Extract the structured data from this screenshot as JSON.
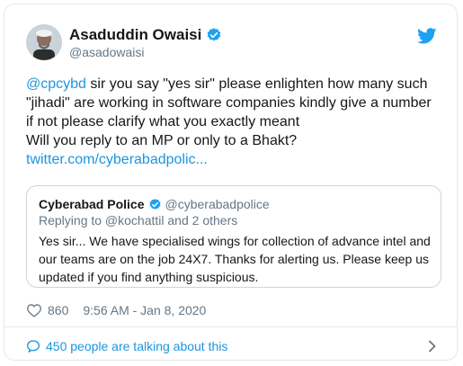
{
  "tweet": {
    "author": {
      "display_name": "Asaduddin Owaisi",
      "handle": "@asadowaisi",
      "verified": true
    },
    "text": {
      "mention": "@cpcybd",
      "line1_rest": " sir you say \"yes sir\" please enlighten how many such",
      "line2": "\"jihadi\" are working in software companies kindly give a number",
      "line3": "if not please clarify what you exactly meant",
      "line4": "Will you reply to an MP or only to a Bhakt?",
      "link": "twitter.com/cyberabadpolic..."
    },
    "quoted_tweet": {
      "display_name": "Cyberabad Police",
      "handle": "@cyberabadpolice",
      "verified": true,
      "replying_to": "Replying to @kochattil and 2 others",
      "text_lines": [
        "Yes sir... We have specialised wings for collection of advance intel and",
        "our teams are on the job 24X7. Thanks for alerting us. Please keep us",
        "updated if you find anything suspicious."
      ]
    },
    "likes_count": "860",
    "timestamp": "9:56 AM - Jan 8, 2020",
    "talking_about": "450 people are talking about this"
  },
  "colors": {
    "link_blue": "#1b95e0",
    "secondary_text": "#657786",
    "verified_blue": "#1da1f2",
    "border": "#e1e8ed"
  },
  "icons": {
    "twitter_logo": "twitter-bird-icon",
    "verified": "verified-badge-icon",
    "like": "heart-icon",
    "comments": "speech-bubble-icon",
    "expand": "chevron-right-icon"
  }
}
